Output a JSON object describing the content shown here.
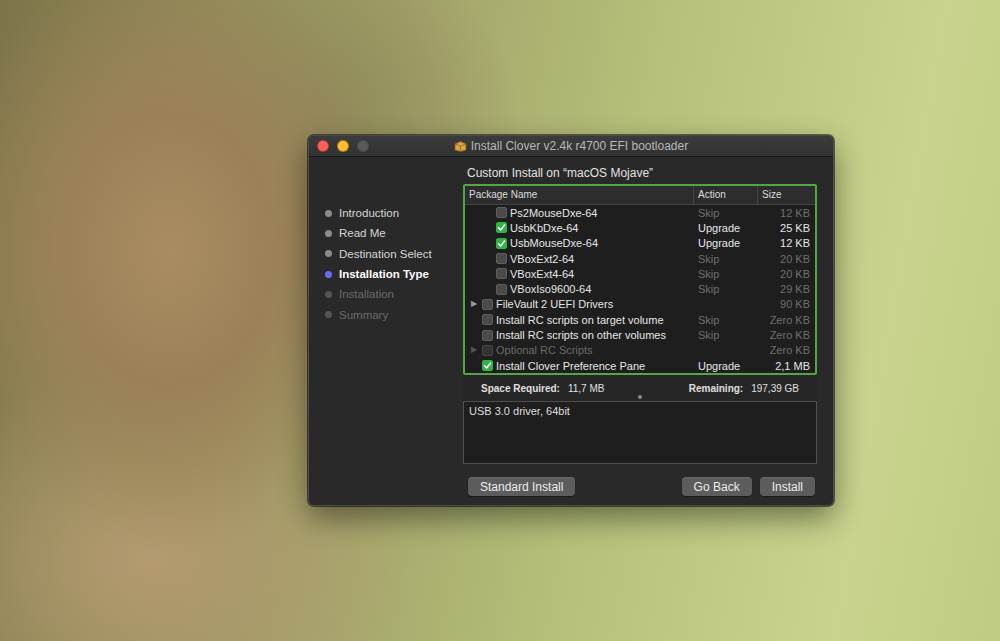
{
  "window": {
    "title": "Install Clover v2.4k r4700 EFI bootloader",
    "traffic_lights": [
      {
        "color": "#fe5f57",
        "disabled": false
      },
      {
        "color": "#febc2e",
        "disabled": false
      },
      {
        "color": "#5a5a5a",
        "disabled": true
      }
    ]
  },
  "steps": [
    {
      "label": "Introduction",
      "selected": false,
      "disabled": false
    },
    {
      "label": "Read Me",
      "selected": false,
      "disabled": false
    },
    {
      "label": "Destination Select",
      "selected": false,
      "disabled": false
    },
    {
      "label": "Installation Type",
      "selected": true,
      "disabled": false
    },
    {
      "label": "Installation",
      "selected": false,
      "disabled": true
    },
    {
      "label": "Summary",
      "selected": false,
      "disabled": true
    }
  ],
  "heading": "Custom Install on “macOS Mojave”",
  "table": {
    "columns": [
      {
        "label": "Package Name"
      },
      {
        "label": "Action"
      },
      {
        "label": "Size"
      }
    ],
    "rows": [
      {
        "kind": "item",
        "level": 1,
        "name": "Ps2MouseDxe-64",
        "checked": false,
        "disabled": false,
        "action": "Skip",
        "muted": true,
        "size": "12 KB"
      },
      {
        "kind": "item",
        "level": 1,
        "name": "UsbKbDxe-64",
        "checked": true,
        "disabled": false,
        "action": "Upgrade",
        "muted": false,
        "size": "25 KB"
      },
      {
        "kind": "item",
        "level": 1,
        "name": "UsbMouseDxe-64",
        "checked": true,
        "disabled": false,
        "action": "Upgrade",
        "muted": false,
        "size": "12 KB"
      },
      {
        "kind": "item",
        "level": 1,
        "name": "VBoxExt2-64",
        "checked": false,
        "disabled": false,
        "action": "Skip",
        "muted": true,
        "size": "20 KB"
      },
      {
        "kind": "item",
        "level": 1,
        "name": "VBoxExt4-64",
        "checked": false,
        "disabled": false,
        "action": "Skip",
        "muted": true,
        "size": "20 KB"
      },
      {
        "kind": "item",
        "level": 1,
        "name": "VBoxIso9600-64",
        "checked": false,
        "disabled": false,
        "action": "Skip",
        "muted": true,
        "size": "29 KB"
      },
      {
        "kind": "group",
        "level": 0,
        "expander": "▶",
        "expanded": false,
        "name": "FileVault 2 UEFI Drivers",
        "checked": false,
        "disabled": false,
        "muted": true,
        "size": "90 KB"
      },
      {
        "kind": "item",
        "level": 0,
        "name": "Install RC scripts on target volume",
        "checked": false,
        "disabled": false,
        "action": "Skip",
        "muted": true,
        "size": "Zero KB"
      },
      {
        "kind": "item",
        "level": 0,
        "name": "Install RC scripts on other volumes",
        "checked": false,
        "disabled": false,
        "action": "Skip",
        "muted": true,
        "size": "Zero KB"
      },
      {
        "kind": "group",
        "level": 0,
        "expander": "▶",
        "expanded": false,
        "name": "Optional RC Scripts",
        "checked": false,
        "disabled": true,
        "muted": true,
        "size": "Zero KB"
      },
      {
        "kind": "item",
        "level": 0,
        "name": "Install Clover Preference Pane",
        "checked": true,
        "disabled": false,
        "action": "Upgrade",
        "muted": false,
        "size": "2,1 MB"
      }
    ]
  },
  "space": {
    "required_label": "Space Required:",
    "required": "11,7 MB",
    "remaining_label": "Remaining:",
    "remaining": "197,39 GB"
  },
  "description": "USB 3.0 driver, 64bit",
  "buttons": [
    {
      "label": "Standard Install"
    },
    {
      "label": "Go Back"
    },
    {
      "label": "Install"
    }
  ]
}
